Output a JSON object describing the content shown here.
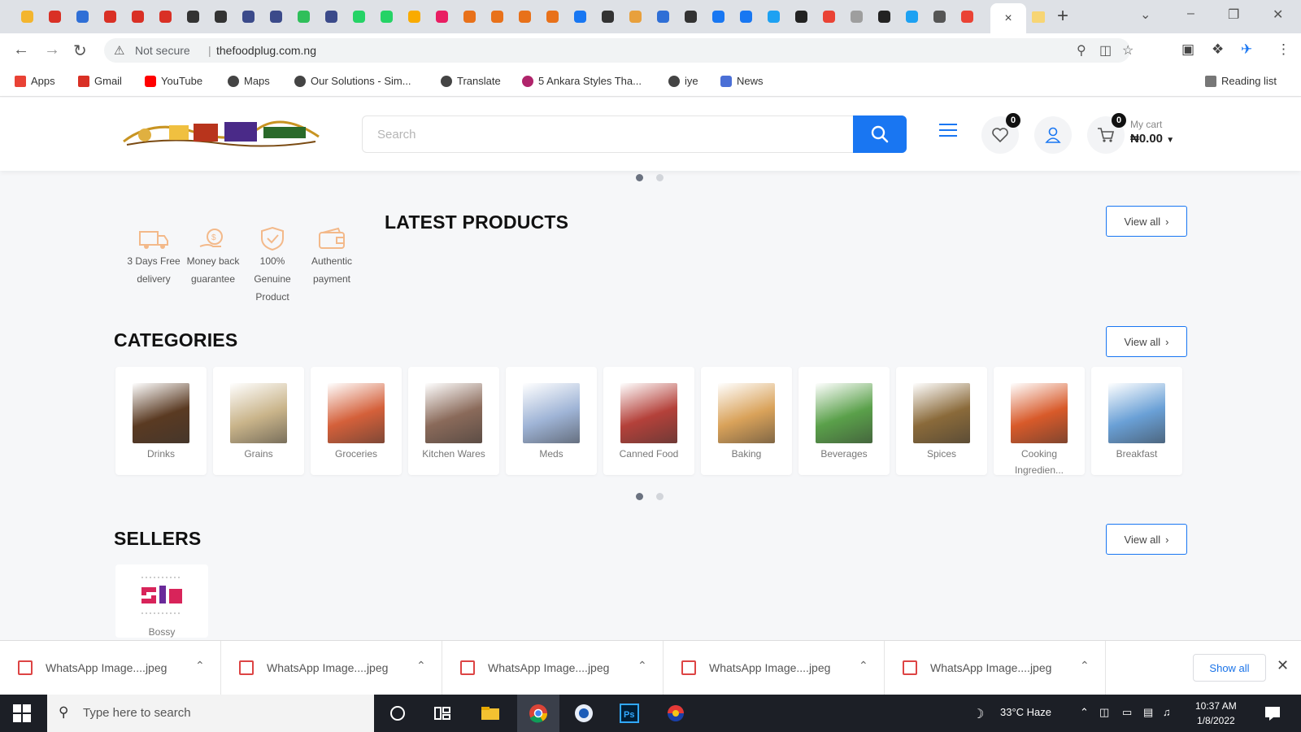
{
  "browser": {
    "tab_favicon_colors": [
      "#f3b52e",
      "#d93025",
      "#2f6fd6",
      "#d93025",
      "#d93025",
      "#d93025",
      "#333333",
      "#333333",
      "#3b4a8a",
      "#3b4a8a",
      "#2fbf5a",
      "#3b4a8a",
      "#25d366",
      "#25d366",
      "#f9ab00",
      "#e91e63",
      "#e8711a",
      "#e8711a",
      "#e8711a",
      "#e8711a",
      "#1877f2",
      "#333333",
      "#e8a03c",
      "#2f6fd6",
      "#333333",
      "#1877f2",
      "#1877f2",
      "#1da1f2",
      "#222222",
      "#ea4335",
      "#9e9e9e",
      "#222222",
      "#1da1f2",
      "#555555",
      "#ea4335"
    ],
    "active_tab_close": "×",
    "new_tab_label": "+",
    "window_controls": [
      "⌄",
      "–",
      "❐",
      "✕"
    ],
    "address": {
      "security_label": "Not secure",
      "separator": "|",
      "url": "thefoodplug.com.ng"
    },
    "bookmarks": [
      {
        "label": "Apps",
        "color": "#e94235"
      },
      {
        "label": "Gmail",
        "color": "#d93025"
      },
      {
        "label": "YouTube",
        "color": "#ff0000"
      },
      {
        "label": "Maps",
        "color": "#444444"
      },
      {
        "label": "Our Solutions - Sim...",
        "color": "#444444"
      },
      {
        "label": "Translate",
        "color": "#444444"
      },
      {
        "label": "5 Ankara Styles Tha...",
        "color": "#b0246b"
      },
      {
        "label": "iye",
        "color": "#444444"
      },
      {
        "label": "News",
        "color": "#4a6fd6"
      }
    ],
    "reading_list": "Reading list"
  },
  "site": {
    "search_placeholder": "Search",
    "wishlist_count": "0",
    "cart_count": "0",
    "cart_label": "My cart",
    "cart_total": "₦0.00",
    "features": [
      {
        "label": "3 Days Free delivery",
        "icon": "truck-icon"
      },
      {
        "label": "Money back guarantee",
        "icon": "money-back-icon"
      },
      {
        "label": "100% Genuine Product",
        "icon": "shield-icon"
      },
      {
        "label": "Authentic payment",
        "icon": "wallet-icon"
      }
    ],
    "latest_products_title": "LATEST PRODUCTS",
    "categories_title": "CATEGORIES",
    "sellers_title": "SELLERS",
    "view_all": "View all",
    "categories": [
      {
        "label": "Drinks",
        "color": "#5a3a22"
      },
      {
        "label": "Grains",
        "color": "#c9b48a"
      },
      {
        "label": "Groceries",
        "color": "#d4603a"
      },
      {
        "label": "Kitchen Wares",
        "color": "#8a6a5a"
      },
      {
        "label": "Meds",
        "color": "#9fb4d6"
      },
      {
        "label": "Canned Food",
        "color": "#b4413a"
      },
      {
        "label": "Baking",
        "color": "#d9a25a"
      },
      {
        "label": "Beverages",
        "color": "#5aa04a"
      },
      {
        "label": "Spices",
        "color": "#8a6a3a"
      },
      {
        "label": "Cooking Ingredien...",
        "color": "#d85a2a"
      },
      {
        "label": "Breakfast",
        "color": "#6aa0d6"
      }
    ],
    "sellers": [
      {
        "label": "Bossy"
      }
    ]
  },
  "downloads": {
    "items": [
      "WhatsApp Image....jpeg",
      "WhatsApp Image....jpeg",
      "WhatsApp Image....jpeg",
      "WhatsApp Image....jpeg",
      "WhatsApp Image....jpeg"
    ],
    "show_all": "Show all"
  },
  "taskbar": {
    "search_placeholder": "Type here to search",
    "weather": "33°C  Haze",
    "time": "10:37 AM",
    "date": "1/8/2022"
  }
}
